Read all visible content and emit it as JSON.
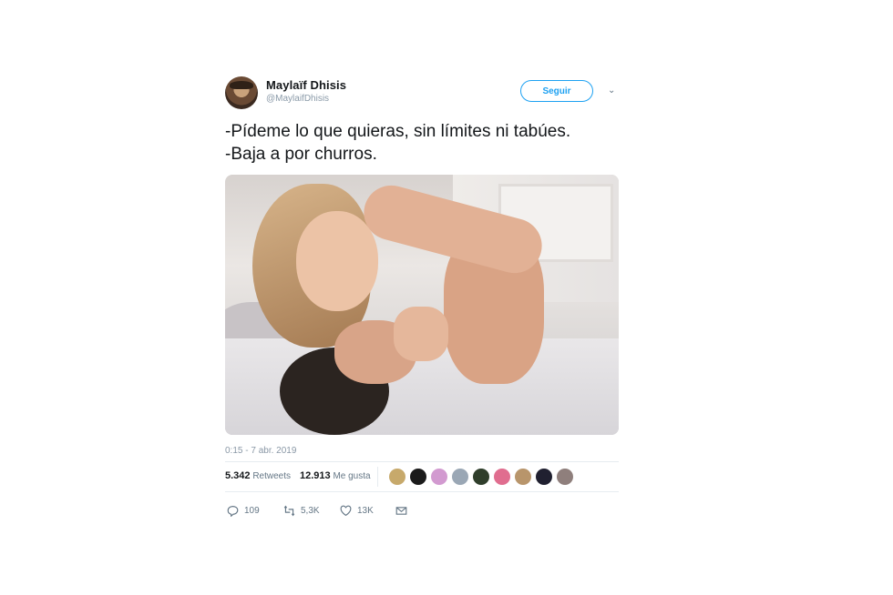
{
  "tweet": {
    "author_name": "Maylaïf Dhisis",
    "author_handle": "@MaylaifDhisis",
    "follow_label": "Seguir",
    "caret": "⌄",
    "text": "-Pídeme lo que quieras, sin límites ni tabúes.\n-Baja a por churros.",
    "timestamp": "0:15 - 7 abr. 2019",
    "retweets_count": "5.342",
    "retweets_label": "Retweets",
    "likes_count": "12.913",
    "likes_label": "Me gusta",
    "replies": "109",
    "retweets_short": "5,3K",
    "likes_short": "13K"
  },
  "liker_avatar_colors": [
    "#c7a96b",
    "#1b1b1b",
    "#d29ad0",
    "#9aa7b5",
    "#2f3e2b",
    "#e06d8f",
    "#b8956b",
    "#202030",
    "#8f7f7c"
  ],
  "colors": {
    "accent": "#1da1f2",
    "muted": "#657786"
  }
}
